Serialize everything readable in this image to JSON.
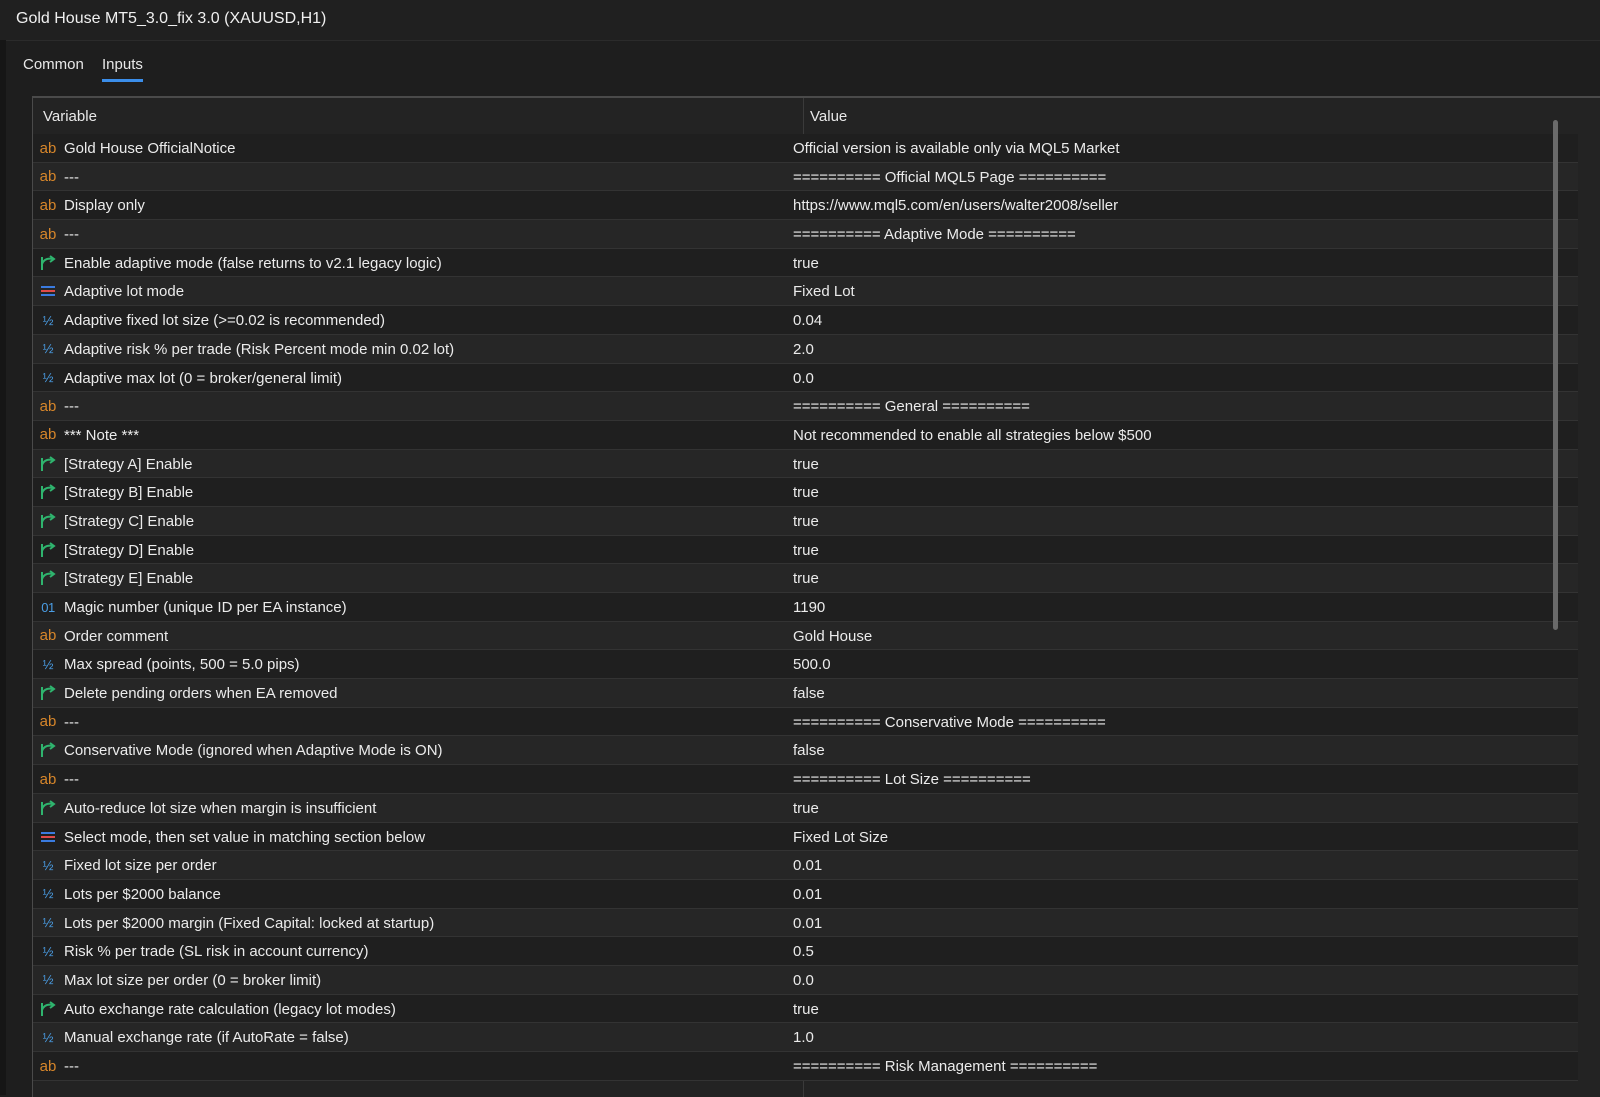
{
  "window": {
    "title": "Gold House MT5_3.0_fix 3.0 (XAUUSD,H1)"
  },
  "tabs": [
    "Common",
    "Inputs"
  ],
  "columns": {
    "variable": "Variable",
    "value": "Value"
  },
  "colors": {
    "accent": "#3b8eea",
    "string_icon": "#d7862a",
    "number_icon": "#4a9de4",
    "bool_icon": "#2fb46e",
    "enum_icon_top": "#3a7be0",
    "enum_icon_bottom": "#e04a4a"
  },
  "rows": [
    {
      "type": "string",
      "icon": "string-icon",
      "variable": "Gold House OfficialNotice",
      "value": "Official version is available only via MQL5 Market"
    },
    {
      "type": "string",
      "icon": "string-icon",
      "variable": "---",
      "value": "========== Official MQL5 Page =========="
    },
    {
      "type": "string",
      "icon": "string-icon",
      "variable": "Display only",
      "value": "https://www.mql5.com/en/users/walter2008/seller"
    },
    {
      "type": "string",
      "icon": "string-icon",
      "variable": "---",
      "value": "========== Adaptive Mode =========="
    },
    {
      "type": "bool",
      "icon": "bool-icon",
      "variable": "Enable adaptive mode (false returns to v2.1 legacy logic)",
      "value": "true"
    },
    {
      "type": "enum",
      "icon": "enum-icon",
      "variable": "Adaptive lot mode",
      "value": "Fixed Lot"
    },
    {
      "type": "double",
      "icon": "double-icon",
      "variable": "Adaptive fixed lot size (>=0.02 is recommended)",
      "value": "0.04"
    },
    {
      "type": "double",
      "icon": "double-icon",
      "variable": "Adaptive risk % per trade (Risk Percent mode min 0.02 lot)",
      "value": "2.0"
    },
    {
      "type": "double",
      "icon": "double-icon",
      "variable": "Adaptive max lot (0 = broker/general limit)",
      "value": "0.0"
    },
    {
      "type": "string",
      "icon": "string-icon",
      "variable": "---",
      "value": "========== General =========="
    },
    {
      "type": "string",
      "icon": "string-icon",
      "variable": "*** Note ***",
      "value": "Not recommended to enable all strategies below $500"
    },
    {
      "type": "bool",
      "icon": "bool-icon",
      "variable": "[Strategy A] Enable",
      "value": "true"
    },
    {
      "type": "bool",
      "icon": "bool-icon",
      "variable": "[Strategy B] Enable",
      "value": "true"
    },
    {
      "type": "bool",
      "icon": "bool-icon",
      "variable": "[Strategy C] Enable",
      "value": "true"
    },
    {
      "type": "bool",
      "icon": "bool-icon",
      "variable": "[Strategy D] Enable",
      "value": "true"
    },
    {
      "type": "bool",
      "icon": "bool-icon",
      "variable": "[Strategy E] Enable",
      "value": "true"
    },
    {
      "type": "int",
      "icon": "integer-icon",
      "variable": "Magic number (unique ID per EA instance)",
      "value": "1190"
    },
    {
      "type": "string",
      "icon": "string-icon",
      "variable": "Order comment",
      "value": "Gold House"
    },
    {
      "type": "double",
      "icon": "double-icon",
      "variable": "Max spread (points, 500 = 5.0 pips)",
      "value": "500.0"
    },
    {
      "type": "bool",
      "icon": "bool-icon",
      "variable": "Delete pending orders when EA removed",
      "value": "false"
    },
    {
      "type": "string",
      "icon": "string-icon",
      "variable": "---",
      "value": "========== Conservative Mode =========="
    },
    {
      "type": "bool",
      "icon": "bool-icon",
      "variable": "Conservative Mode (ignored when Adaptive Mode is ON)",
      "value": "false"
    },
    {
      "type": "string",
      "icon": "string-icon",
      "variable": "---",
      "value": "========== Lot Size =========="
    },
    {
      "type": "bool",
      "icon": "bool-icon",
      "variable": "Auto-reduce lot size when margin is insufficient",
      "value": "true"
    },
    {
      "type": "enum",
      "icon": "enum-icon",
      "variable": "Select mode, then set value in matching section below",
      "value": "Fixed Lot Size"
    },
    {
      "type": "double",
      "icon": "double-icon",
      "variable": "Fixed lot size per order",
      "value": "0.01"
    },
    {
      "type": "double",
      "icon": "double-icon",
      "variable": "Lots per $2000 balance",
      "value": "0.01"
    },
    {
      "type": "double",
      "icon": "double-icon",
      "variable": "Lots per $2000 margin (Fixed Capital: locked at startup)",
      "value": "0.01"
    },
    {
      "type": "double",
      "icon": "double-icon",
      "variable": "Risk % per trade (SL risk in account currency)",
      "value": "0.5"
    },
    {
      "type": "double",
      "icon": "double-icon",
      "variable": "Max lot size per order (0 = broker limit)",
      "value": "0.0"
    },
    {
      "type": "bool",
      "icon": "bool-icon",
      "variable": "Auto exchange rate calculation (legacy lot modes)",
      "value": "true"
    },
    {
      "type": "double",
      "icon": "double-icon",
      "variable": "Manual exchange rate (if AutoRate = false)",
      "value": "1.0"
    },
    {
      "type": "string",
      "icon": "string-icon",
      "variable": "---",
      "value": "========== Risk Management =========="
    }
  ]
}
